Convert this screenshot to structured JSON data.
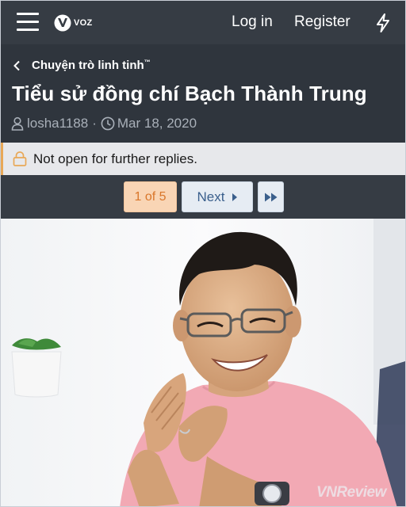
{
  "nav": {
    "logo_text": "VOZ",
    "login_label": "Log in",
    "register_label": "Register"
  },
  "breadcrumb": {
    "label": "Chuyện trò linh tinh",
    "mark": "™"
  },
  "thread": {
    "title": "Tiểu sử đồng chí Bạch Thành Trung",
    "author": "losha1188",
    "separator": "·",
    "date": "Mar 18, 2020"
  },
  "notice": {
    "text": "Not open for further replies."
  },
  "pagination": {
    "current": "1 of 5",
    "next_label": "Next"
  },
  "photo": {
    "watermark": "VNReview"
  },
  "colors": {
    "nav_bg": "#363c44",
    "header_bg": "#2f353d",
    "notice_accent": "#e8a857",
    "page_current_bg": "#f9d5b5",
    "page_button_bg": "#e6ecf3"
  }
}
